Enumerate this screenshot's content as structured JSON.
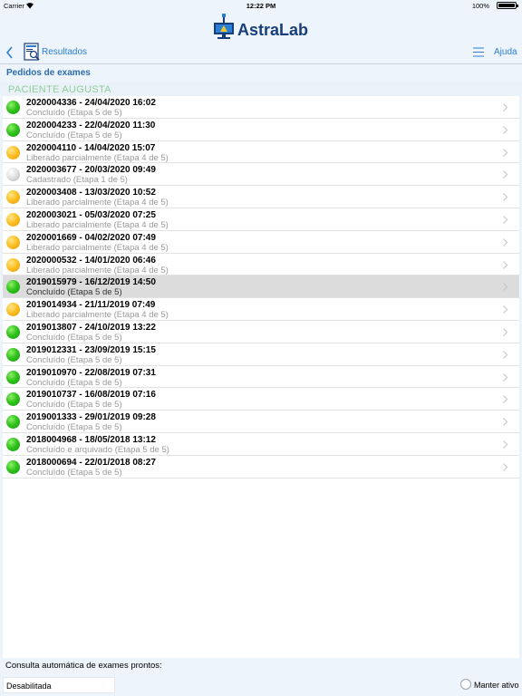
{
  "status_bar": {
    "carrier": "Carrier",
    "time": "12:22 PM",
    "battery": "100%"
  },
  "app": {
    "logo_text": "AstraLab"
  },
  "nav": {
    "back_label": "Resultados",
    "help_label": "Ajuda"
  },
  "section": {
    "title": "Pedidos de exames"
  },
  "patient": {
    "header": "PACIENTE AUGUSTA"
  },
  "colors": {
    "accent": "#2a7fd3",
    "patient_header": "#8fd09b",
    "concluded": "#32c41d",
    "partial": "#fbbd1f",
    "registered": "#c8c8c8"
  },
  "exams": [
    {
      "title": "2020004336 - 24/04/2020 16:02",
      "status": "Concluído (Etapa 5 de 5)",
      "color": "green"
    },
    {
      "title": "2020004233 - 22/04/2020 11:30",
      "status": "Concluído (Etapa 5 de 5)",
      "color": "green"
    },
    {
      "title": "2020004110 - 14/04/2020 15:07",
      "status": "Liberado parcialmente (Etapa 4 de 5)",
      "color": "yellow"
    },
    {
      "title": "2020003677 - 20/03/2020 09:49",
      "status": "Cadastrado (Etapa 1 de 5)",
      "color": "gray"
    },
    {
      "title": "2020003408 - 13/03/2020 10:52",
      "status": "Liberado parcialmente (Etapa 4 de 5)",
      "color": "yellow"
    },
    {
      "title": "2020003021 - 05/03/2020 07:25",
      "status": "Liberado parcialmente (Etapa 4 de 5)",
      "color": "yellow"
    },
    {
      "title": "2020001669 - 04/02/2020 07:49",
      "status": "Liberado parcialmente (Etapa 4 de 5)",
      "color": "yellow"
    },
    {
      "title": "2020000532 - 14/01/2020 06:46",
      "status": "Liberado parcialmente (Etapa 4 de 5)",
      "color": "yellow"
    },
    {
      "title": "2019015979 - 16/12/2019 14:50",
      "status": "Concluído (Etapa 5 de 5)",
      "color": "green",
      "selected": true
    },
    {
      "title": "2019014934 - 21/11/2019 07:49",
      "status": "Liberado parcialmente (Etapa 4 de 5)",
      "color": "yellow"
    },
    {
      "title": "2019013807 - 24/10/2019 13:22",
      "status": "Concluído (Etapa 5 de 5)",
      "color": "green"
    },
    {
      "title": "2019012331 - 23/09/2019 15:15",
      "status": "Concluído (Etapa 5 de 5)",
      "color": "green"
    },
    {
      "title": "2019010970 - 22/08/2019 07:31",
      "status": "Concluído (Etapa 5 de 5)",
      "color": "green"
    },
    {
      "title": "2019010737 - 16/08/2019 07:16",
      "status": "Concluído (Etapa 5 de 5)",
      "color": "green"
    },
    {
      "title": "2019001333 - 29/01/2019 09:28",
      "status": "Concluído (Etapa 5 de 5)",
      "color": "green"
    },
    {
      "title": "2018004968 - 18/05/2018 13:12",
      "status": "Concluído e arquivado (Etapa 5 de 5)",
      "color": "green"
    },
    {
      "title": "2018000694 - 22/01/2018 08:27",
      "status": "Concluído (Etapa 5 de 5)",
      "color": "green"
    }
  ],
  "footer": {
    "auto_label": "Consulta automática de exames prontos:",
    "auto_value": "Desabilitada",
    "keep_active_label": "Manter ativo"
  }
}
